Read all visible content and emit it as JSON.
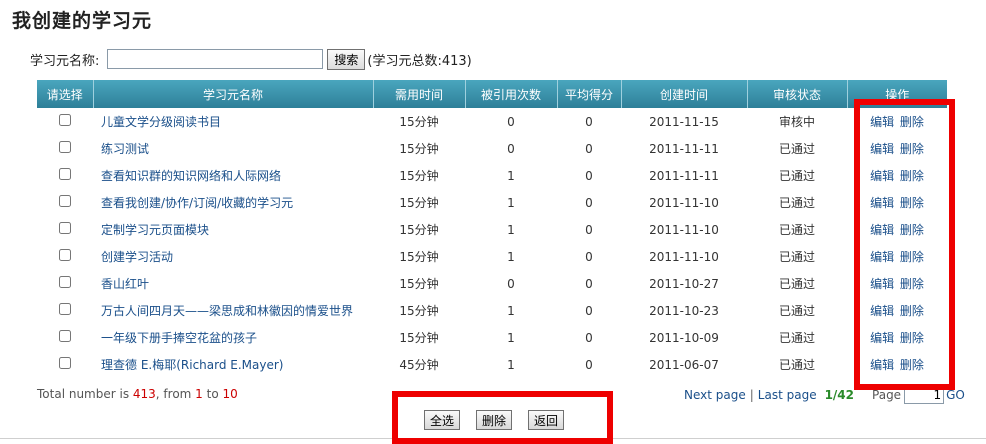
{
  "page_title": "我创建的学习元",
  "search": {
    "label": "学习元名称:",
    "value": "",
    "placeholder": "",
    "button": "搜索",
    "total": "(学习元总数:413)"
  },
  "table": {
    "headers": [
      "请选择",
      "学习元名称",
      "需用时间",
      "被引用次数",
      "平均得分",
      "创建时间",
      "审核状态",
      "操作"
    ],
    "edit_label": "编辑",
    "delete_label": "删除",
    "rows": [
      {
        "name": "儿童文学分级阅读书目",
        "time": "15分钟",
        "refs": "0",
        "score": "0",
        "date": "2011-11-15",
        "status": "审核中"
      },
      {
        "name": "练习测试",
        "time": "15分钟",
        "refs": "0",
        "score": "0",
        "date": "2011-11-11",
        "status": "已通过"
      },
      {
        "name": "查看知识群的知识网络和人际网络",
        "time": "15分钟",
        "refs": "1",
        "score": "0",
        "date": "2011-11-11",
        "status": "已通过"
      },
      {
        "name": "查看我创建/协作/订阅/收藏的学习元",
        "time": "15分钟",
        "refs": "1",
        "score": "0",
        "date": "2011-11-10",
        "status": "已通过"
      },
      {
        "name": "定制学习元页面模块",
        "time": "15分钟",
        "refs": "1",
        "score": "0",
        "date": "2011-11-10",
        "status": "已通过"
      },
      {
        "name": "创建学习活动",
        "time": "15分钟",
        "refs": "1",
        "score": "0",
        "date": "2011-11-10",
        "status": "已通过"
      },
      {
        "name": "香山红叶",
        "time": "15分钟",
        "refs": "0",
        "score": "0",
        "date": "2011-10-27",
        "status": "已通过"
      },
      {
        "name": "万古人间四月天——梁思成和林徽因的情爱世界",
        "time": "15分钟",
        "refs": "1",
        "score": "0",
        "date": "2011-10-23",
        "status": "已通过"
      },
      {
        "name": "一年级下册手捧空花盆的孩子",
        "time": "15分钟",
        "refs": "1",
        "score": "0",
        "date": "2011-10-09",
        "status": "已通过"
      },
      {
        "name": "理查德 E.梅耶(Richard E.Mayer)",
        "time": "45分钟",
        "refs": "1",
        "score": "0",
        "date": "2011-06-07",
        "status": "已通过"
      }
    ]
  },
  "footer": {
    "total_prefix": "Total number is ",
    "total": "413",
    "from_text": ", from ",
    "from": "1",
    "to_text": " to ",
    "to": "10"
  },
  "pager": {
    "next": "Next page",
    "separator": "|",
    "last": "Last page",
    "count": "1/42",
    "page_label": "Page",
    "page_value": "1",
    "go": "GO"
  },
  "actions": {
    "select_all": "全选",
    "delete": "删除",
    "back": "返回"
  },
  "colors": {
    "header_bg": "#3a93ad",
    "link": "#1a4f8a",
    "highlight": "#ee0000",
    "pager_count": "#2a8a2a"
  }
}
